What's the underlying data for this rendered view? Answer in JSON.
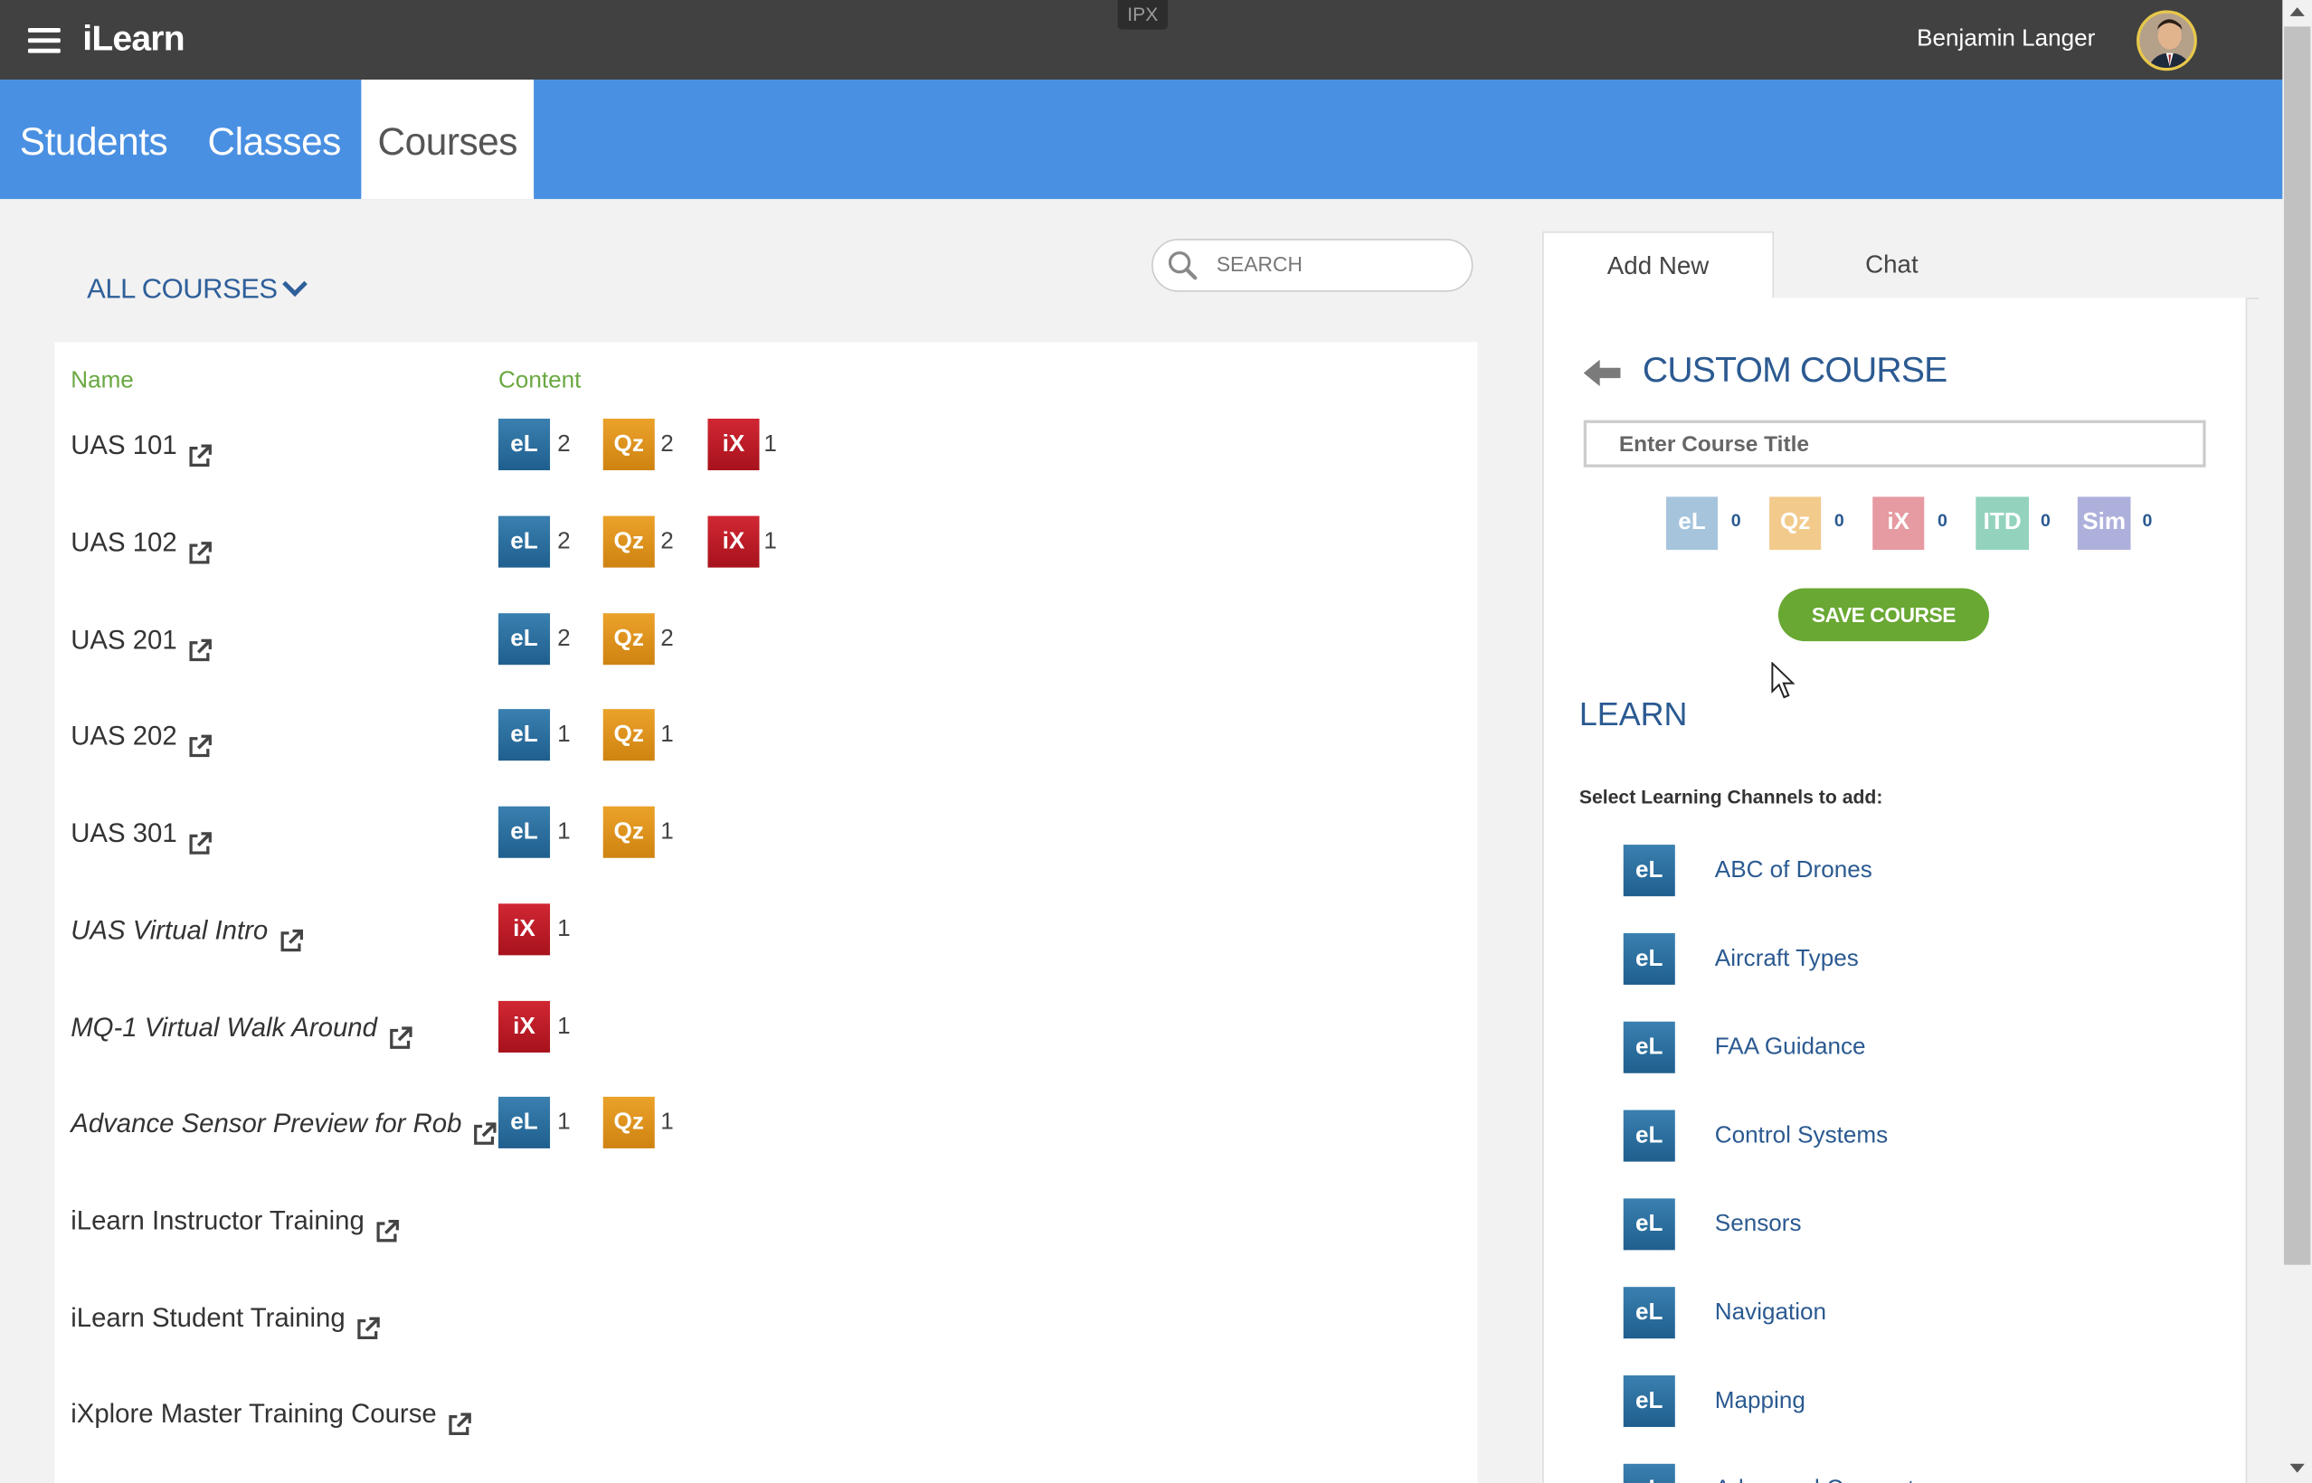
{
  "app": {
    "brand": "iLearn",
    "env_badge": "IPX",
    "user_name": "Benjamin Langer"
  },
  "nav": {
    "tabs": [
      {
        "label": "Students"
      },
      {
        "label": "Classes"
      },
      {
        "label": "Courses",
        "active": true
      }
    ]
  },
  "filter": {
    "label": "ALL COURSES",
    "search_placeholder": "SEARCH"
  },
  "table": {
    "headers": {
      "name": "Name",
      "content": "Content"
    },
    "rows": [
      {
        "name": "UAS 101",
        "italic": false,
        "content": [
          {
            "type": "eL",
            "count": "2"
          },
          {
            "type": "Qz",
            "count": "2"
          },
          {
            "type": "iX",
            "count": "1"
          }
        ]
      },
      {
        "name": "UAS 102",
        "italic": false,
        "content": [
          {
            "type": "eL",
            "count": "2"
          },
          {
            "type": "Qz",
            "count": "2"
          },
          {
            "type": "iX",
            "count": "1"
          }
        ]
      },
      {
        "name": "UAS 201",
        "italic": false,
        "content": [
          {
            "type": "eL",
            "count": "2"
          },
          {
            "type": "Qz",
            "count": "2"
          }
        ]
      },
      {
        "name": "UAS 202",
        "italic": false,
        "content": [
          {
            "type": "eL",
            "count": "1"
          },
          {
            "type": "Qz",
            "count": "1"
          }
        ]
      },
      {
        "name": "UAS 301",
        "italic": false,
        "content": [
          {
            "type": "eL",
            "count": "1"
          },
          {
            "type": "Qz",
            "count": "1"
          }
        ]
      },
      {
        "name": "UAS Virtual Intro",
        "italic": true,
        "content": [
          {
            "type": "iX",
            "count": "1"
          }
        ]
      },
      {
        "name": "MQ-1 Virtual Walk Around",
        "italic": true,
        "content": [
          {
            "type": "iX",
            "count": "1"
          }
        ]
      },
      {
        "name": "Advance Sensor Preview for Rob",
        "italic": true,
        "content": [
          {
            "type": "eL",
            "count": "1"
          },
          {
            "type": "Qz",
            "count": "1"
          }
        ]
      },
      {
        "name": "iLearn Instructor Training",
        "italic": false,
        "content": []
      },
      {
        "name": "iLearn Student Training",
        "italic": false,
        "content": []
      },
      {
        "name": "iXplore Master Training Course",
        "italic": false,
        "content": []
      }
    ]
  },
  "side": {
    "tabs": [
      {
        "label": "Add New",
        "active": true
      },
      {
        "label": "Chat",
        "active": false
      }
    ],
    "title": "CUSTOM COURSE",
    "input_placeholder": "Enter Course Title",
    "summary": [
      {
        "type": "eL",
        "count": "0",
        "color": "#a6c4dc"
      },
      {
        "type": "Qz",
        "count": "0",
        "color": "#f2ca8c"
      },
      {
        "type": "iX",
        "count": "0",
        "color": "#e69aa1"
      },
      {
        "type": "ITD",
        "count": "0",
        "color": "#93d3bd"
      },
      {
        "type": "Sim",
        "count": "0",
        "color": "#aeb0dc"
      }
    ],
    "save_label": "SAVE COURSE",
    "section_title": "LEARN",
    "select_label": "Select Learning Channels to add:",
    "channels": [
      {
        "type": "eL",
        "label": "ABC of Drones"
      },
      {
        "type": "eL",
        "label": "Aircraft Types"
      },
      {
        "type": "eL",
        "label": "FAA Guidance"
      },
      {
        "type": "eL",
        "label": "Control Systems"
      },
      {
        "type": "eL",
        "label": "Sensors"
      },
      {
        "type": "eL",
        "label": "Navigation"
      },
      {
        "type": "eL",
        "label": "Mapping"
      },
      {
        "type": "eL",
        "label": "Advanced Concepts"
      }
    ]
  },
  "colors": {
    "topbar": "#414141",
    "nav": "#4a90e2",
    "eL": "#2a6f9f",
    "Qz": "#e0931c",
    "iX": "#bd1b27",
    "save": "#69a833",
    "link": "#2b5a91",
    "header_green": "#6aa842"
  },
  "icons": {
    "menu": "hamburger-icon",
    "external": "external-link-icon",
    "search": "search-icon",
    "back": "arrow-left-icon",
    "dropdown": "chevron-down-icon"
  }
}
